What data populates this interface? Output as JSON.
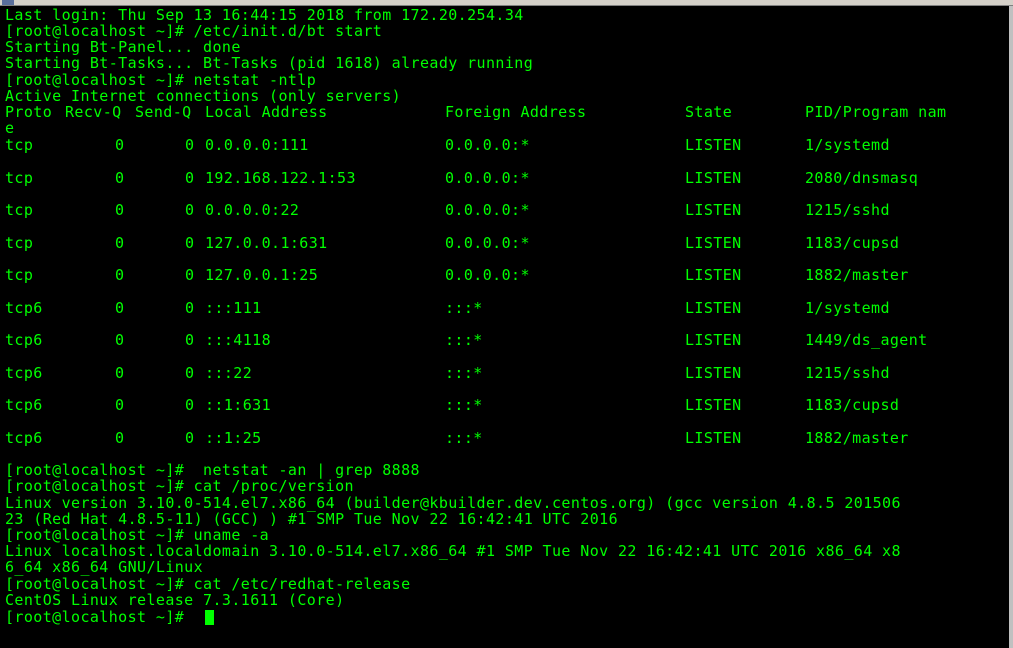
{
  "terminal": {
    "text_color": "#00ff00",
    "background_color": "#000000",
    "lines_before": [
      "Last login: Thu Sep 13 16:44:15 2018 from 172.20.254.34",
      "[root@localhost ~]# /etc/init.d/bt start",
      "Starting Bt-Panel... done",
      "Starting Bt-Tasks... Bt-Tasks (pid 1618) already running",
      "[root@localhost ~]# netstat -ntlp",
      "Active Internet connections (only servers)"
    ],
    "table_header": {
      "proto": "Proto",
      "recv": "Recv-Q",
      "send": "Send-Q",
      "local": "Local Address",
      "foreign": "Foreign Address",
      "state": "State",
      "pid": "PID/Program nam",
      "wrap": "e"
    },
    "table_rows": [
      {
        "proto": "tcp",
        "recv": "0",
        "send": "0",
        "local": "0.0.0.0:111",
        "foreign": "0.0.0.0:*",
        "state": "LISTEN",
        "pid": "1/systemd"
      },
      {
        "proto": "tcp",
        "recv": "0",
        "send": "0",
        "local": "192.168.122.1:53",
        "foreign": "0.0.0.0:*",
        "state": "LISTEN",
        "pid": "2080/dnsmasq"
      },
      {
        "proto": "tcp",
        "recv": "0",
        "send": "0",
        "local": "0.0.0.0:22",
        "foreign": "0.0.0.0:*",
        "state": "LISTEN",
        "pid": "1215/sshd"
      },
      {
        "proto": "tcp",
        "recv": "0",
        "send": "0",
        "local": "127.0.0.1:631",
        "foreign": "0.0.0.0:*",
        "state": "LISTEN",
        "pid": "1183/cupsd"
      },
      {
        "proto": "tcp",
        "recv": "0",
        "send": "0",
        "local": "127.0.0.1:25",
        "foreign": "0.0.0.0:*",
        "state": "LISTEN",
        "pid": "1882/master"
      },
      {
        "proto": "tcp6",
        "recv": "0",
        "send": "0",
        "local": ":::111",
        "foreign": ":::*",
        "state": "LISTEN",
        "pid": "1/systemd"
      },
      {
        "proto": "tcp6",
        "recv": "0",
        "send": "0",
        "local": ":::4118",
        "foreign": ":::*",
        "state": "LISTEN",
        "pid": "1449/ds_agent"
      },
      {
        "proto": "tcp6",
        "recv": "0",
        "send": "0",
        "local": ":::22",
        "foreign": ":::*",
        "state": "LISTEN",
        "pid": "1215/sshd"
      },
      {
        "proto": "tcp6",
        "recv": "0",
        "send": "0",
        "local": "::1:631",
        "foreign": ":::*",
        "state": "LISTEN",
        "pid": "1183/cupsd"
      },
      {
        "proto": "tcp6",
        "recv": "0",
        "send": "0",
        "local": "::1:25",
        "foreign": ":::*",
        "state": "LISTEN",
        "pid": "1882/master"
      }
    ],
    "lines_after": [
      "[root@localhost ~]#  netstat -an | grep 8888",
      "[root@localhost ~]# cat /proc/version",
      "Linux version 3.10.0-514.el7.x86_64 (builder@kbuilder.dev.centos.org) (gcc version 4.8.5 201506",
      "23 (Red Hat 4.8.5-11) (GCC) ) #1 SMP Tue Nov 22 16:42:41 UTC 2016",
      "[root@localhost ~]# uname -a",
      "Linux localhost.localdomain 3.10.0-514.el7.x86_64 #1 SMP Tue Nov 22 16:42:41 UTC 2016 x86_64 x8",
      "6_64 x86_64 GNU/Linux",
      "[root@localhost ~]# cat /etc/redhat-release",
      "CentOS Linux release 7.3.1611 (Core)",
      "[root@localhost ~]# "
    ]
  }
}
